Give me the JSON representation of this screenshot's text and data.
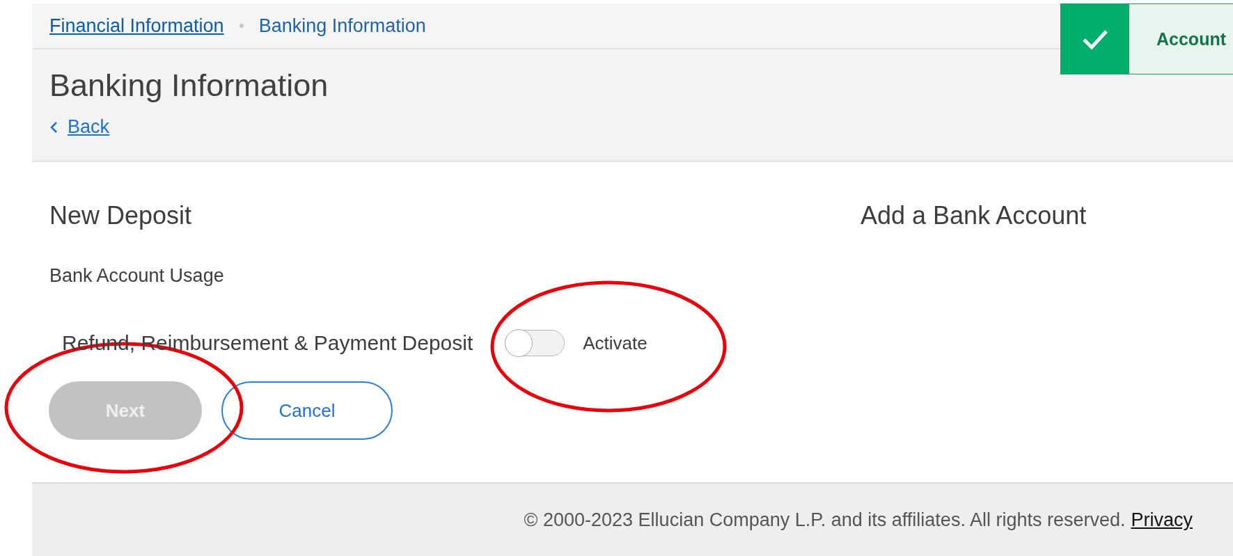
{
  "breadcrumbs": [
    {
      "label": "Financial Information",
      "link": true
    },
    {
      "label": "Banking Information",
      "link": false
    }
  ],
  "page_title": "Banking Information",
  "back_link": "Back",
  "toast": {
    "message": "Account"
  },
  "section_title": "New Deposit",
  "side_title": "Add a Bank Account",
  "usage_label": "Bank Account Usage",
  "usage_row": {
    "label": "Refund, Reimbursement & Payment Deposit",
    "toggle_on": false,
    "toggle_label": "Activate"
  },
  "buttons": [
    {
      "label": "Next",
      "kind": "primary",
      "disabled": true
    },
    {
      "label": "Cancel",
      "kind": "secondary",
      "disabled": false
    }
  ],
  "footer": {
    "text": "© 2000-2023 Ellucian Company L.P. and its affiliates. All rights reserved.",
    "link": "Privacy"
  }
}
